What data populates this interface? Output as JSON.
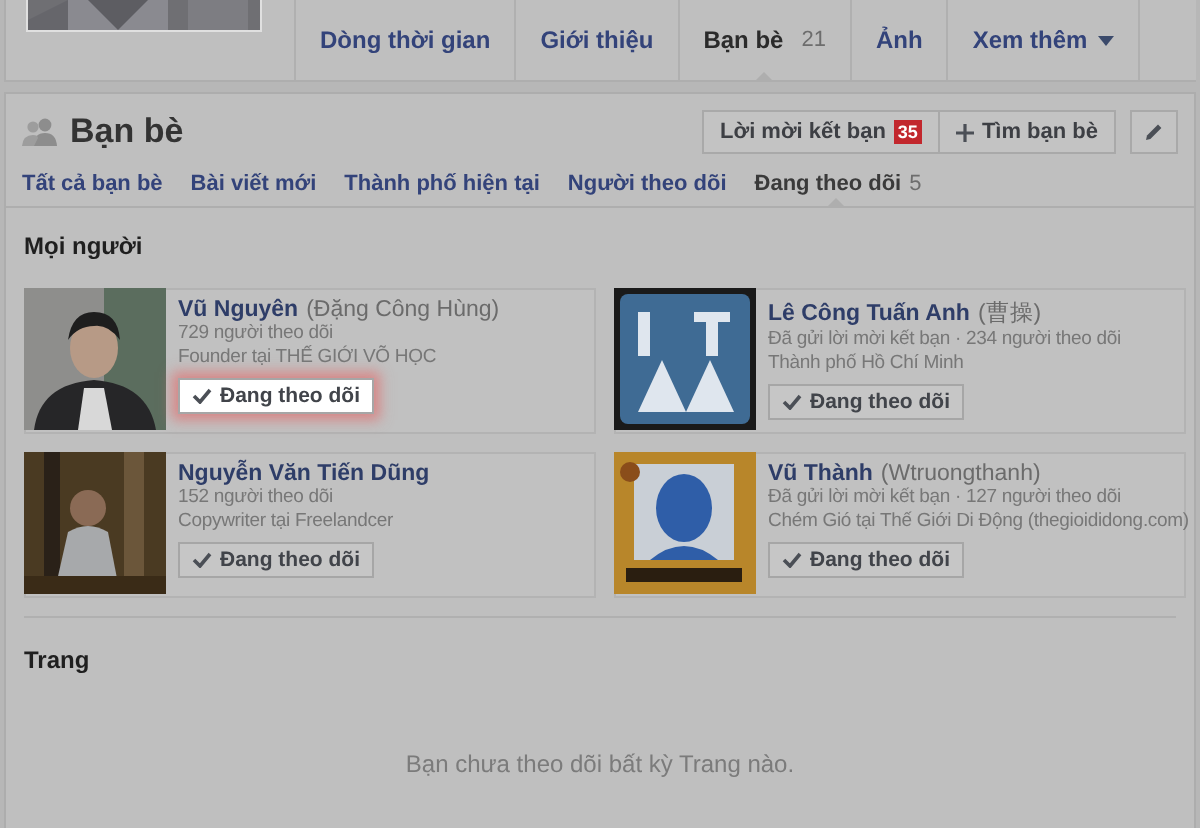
{
  "profile_tabs": [
    {
      "label": "Dòng thời gian",
      "selected": false
    },
    {
      "label": "Giới thiệu",
      "selected": false
    },
    {
      "label": "Bạn bè",
      "count": "21",
      "selected": true
    },
    {
      "label": "Ảnh",
      "selected": false
    },
    {
      "label": "Xem thêm",
      "dropdown": true,
      "selected": false
    }
  ],
  "friends_section": {
    "title": "Bạn bè",
    "friend_requests_button": {
      "label": "Lời mời kết bạn",
      "badge": "35"
    },
    "find_friends_button": {
      "label": "Tìm bạn bè"
    }
  },
  "sub_tabs": [
    {
      "label": "Tất cả bạn bè",
      "selected": false
    },
    {
      "label": "Bài viết mới",
      "selected": false
    },
    {
      "label": "Thành phố hiện tại",
      "selected": false
    },
    {
      "label": "Người theo dõi",
      "selected": false
    },
    {
      "label": "Đang theo dõi",
      "count": "5",
      "selected": true
    }
  ],
  "people": {
    "title": "Mọi người",
    "items": [
      {
        "name": "Vũ Nguyên",
        "alt_name": "(Đặng Công Hùng)",
        "lines": [
          "729 người theo dõi",
          "Founder tại THẾ GIỚI VÕ HỌC"
        ],
        "button": "Đang theo dõi",
        "highlighted": true
      },
      {
        "name": "Lê Công Tuấn Anh",
        "alt_name": "(曹操)",
        "lines": [
          "Đã gửi lời mời kết bạn · 234 người theo dõi",
          "Thành phố Hồ Chí Minh"
        ],
        "button": "Đang theo dõi",
        "highlighted": false
      },
      {
        "name": "Nguyễn Văn Tiến Dũng",
        "lines": [
          "152 người theo dõi",
          "Copywriter tại Freelandcer"
        ],
        "button": "Đang theo dõi",
        "highlighted": false
      },
      {
        "name": "Vũ Thành",
        "alt_name": "(Wtruongthanh)",
        "lines": [
          "Đã gửi lời mời kết bạn · 127 người theo dõi",
          "Chém Gió tại Thế Giới Di Động (thegioididong.com)"
        ],
        "button": "Đang theo dõi",
        "highlighted": false
      }
    ]
  },
  "pages": {
    "title": "Trang",
    "empty_message": "Bạn chưa theo dõi bất kỳ Trang nào."
  }
}
